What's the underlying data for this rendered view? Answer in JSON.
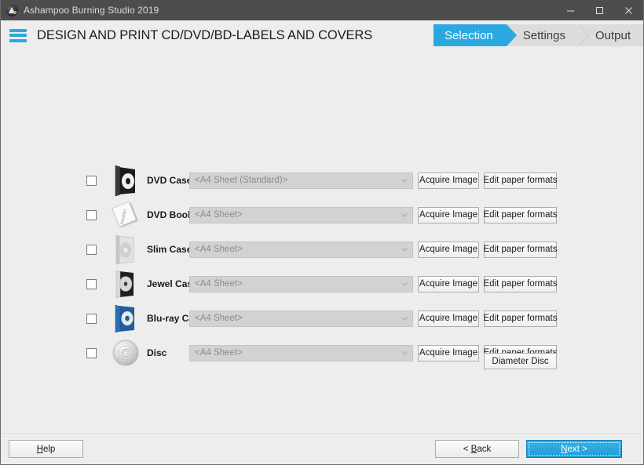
{
  "window": {
    "title": "Ashampoo Burning Studio 2019",
    "app_icon": "ashampoo-logo-icon",
    "controls": {
      "minimize": "minimize-icon",
      "maximize": "maximize-icon",
      "close": "close-icon"
    }
  },
  "header": {
    "menu_icon": "hamburger-menu-icon",
    "title": "DESIGN AND PRINT CD/DVD/BD-LABELS AND COVERS",
    "accent_color": "#2ba8e0",
    "steps": [
      {
        "label": "Selection",
        "active": true
      },
      {
        "label": "Settings",
        "active": false
      },
      {
        "label": "Output",
        "active": false
      }
    ]
  },
  "main": {
    "rows": [
      {
        "label": "DVD Case",
        "icon": "dvd-case-icon",
        "checked": false,
        "paper_format": "<A4 Sheet (Standard)>",
        "acquire_label": "Acquire Image",
        "edit_label": "Edit paper formats"
      },
      {
        "label": "DVD Booklet",
        "icon": "dvd-booklet-icon",
        "checked": false,
        "paper_format": "<A4 Sheet>",
        "acquire_label": "Acquire Image",
        "edit_label": "Edit paper formats"
      },
      {
        "label": "Slim Case",
        "icon": "slim-case-icon",
        "checked": false,
        "paper_format": "<A4 Sheet>",
        "acquire_label": "Acquire Image",
        "edit_label": "Edit paper formats"
      },
      {
        "label": "Jewel Case",
        "icon": "jewel-case-icon",
        "checked": false,
        "paper_format": "<A4 Sheet>",
        "acquire_label": "Acquire Image",
        "edit_label": "Edit paper formats"
      },
      {
        "label": "Blu-ray Case",
        "icon": "bluray-case-icon",
        "checked": false,
        "paper_format": "<A4 Sheet>",
        "acquire_label": "Acquire Image",
        "edit_label": "Edit paper formats"
      },
      {
        "label": "Disc",
        "icon": "disc-icon",
        "checked": false,
        "paper_format": "<A4 Sheet>",
        "acquire_label": "Acquire Image",
        "edit_label": "Edit paper formats",
        "extra_label": "Diameter Disc"
      }
    ]
  },
  "footer": {
    "help": "Help",
    "help_mnemonic": "H",
    "back": "< Back",
    "back_mnemonic": "B",
    "next": "Next >",
    "next_mnemonic": "N"
  }
}
